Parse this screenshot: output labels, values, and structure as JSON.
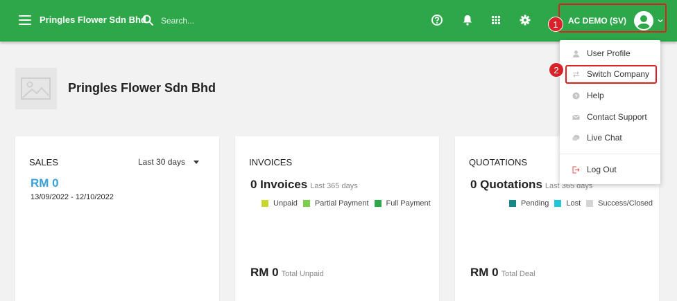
{
  "header": {
    "brand": "Pringles Flower Sdn Bhd",
    "search_placeholder": "Search...",
    "user_name": "AC DEMO (SV)"
  },
  "annotations": {
    "step1": "1",
    "step2": "2"
  },
  "company": {
    "name": "Pringles Flower Sdn Bhd"
  },
  "user_menu": {
    "items": [
      "User Profile",
      "Switch Company",
      "Help",
      "Contact Support",
      "Live Chat"
    ],
    "logout": "Log Out"
  },
  "sales": {
    "title": "SALES",
    "period": "Last 30 days",
    "amount": "RM 0",
    "range": "13/09/2022 - 12/10/2022"
  },
  "invoices": {
    "title": "INVOICES",
    "count": "0 Invoices",
    "count_sub": "Last 365 days",
    "legend": [
      {
        "label": "Unpaid",
        "color": "#c8d62e"
      },
      {
        "label": "Partial Payment",
        "color": "#7bcf4a"
      },
      {
        "label": "Full Payment",
        "color": "#2ea74a"
      }
    ],
    "total": "RM 0",
    "total_sub": "Total Unpaid"
  },
  "quotations": {
    "title": "QUOTATIONS",
    "count": "0 Quotations",
    "count_sub": "Last 365 days",
    "legend": [
      {
        "label": "Pending",
        "color": "#138a87"
      },
      {
        "label": "Lost",
        "color": "#1ec6d6"
      },
      {
        "label": "Success/Closed",
        "color": "#d4d4d4"
      }
    ],
    "total": "RM 0",
    "total_sub": "Total Deal"
  },
  "colors": {
    "topbar": "#2ea74a",
    "accent_blue": "#3aa0d8",
    "annotation_red": "#e02020"
  }
}
